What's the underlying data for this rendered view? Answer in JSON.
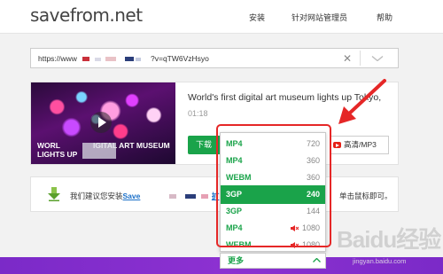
{
  "header": {
    "logo": "savefrom.net",
    "nav": [
      "安装",
      "针对网站管理员",
      "帮助"
    ]
  },
  "search": {
    "url_prefix": "https://www",
    "url_suffix": "?v=qTW6VzHsyo",
    "clear_icon": "close-icon",
    "expand_icon": "chevron-down-icon"
  },
  "video": {
    "title": "World's first digital art museum lights up Tokyo,",
    "duration": "01:18",
    "thumb_caption_line1": "WORL",
    "thumb_caption_line1b": "IGITAL ART MUSEUM",
    "thumb_caption_line2": "LIGHTS UP",
    "download_label": "下载",
    "hq_label": "高清/MP3"
  },
  "formats": [
    {
      "format": "MP4",
      "quality": "720",
      "muted": false,
      "selected": false
    },
    {
      "format": "MP4",
      "quality": "360",
      "muted": false,
      "selected": false
    },
    {
      "format": "WEBM",
      "quality": "360",
      "muted": false,
      "selected": false
    },
    {
      "format": "3GP",
      "quality": "240",
      "muted": false,
      "selected": true
    },
    {
      "format": "3GP",
      "quality": "144",
      "muted": false,
      "selected": false
    },
    {
      "format": "MP4",
      "quality": "1080",
      "muted": true,
      "selected": false
    },
    {
      "format": "WEBM",
      "quality": "1080",
      "muted": true,
      "selected": false
    }
  ],
  "more_label": "更多",
  "suggestion": {
    "text_prefix": "我们建议您安装",
    "link": "Save",
    "text_mid": "扩",
    "text_end": "单击鼠标即可。"
  },
  "watermark": {
    "main": "Baidu经验",
    "sub": "jingyan.baidu.com"
  },
  "colors": {
    "accent_green": "#1aa34a",
    "highlight_red": "#e52727",
    "footer_purple": "#7b2ac8"
  }
}
